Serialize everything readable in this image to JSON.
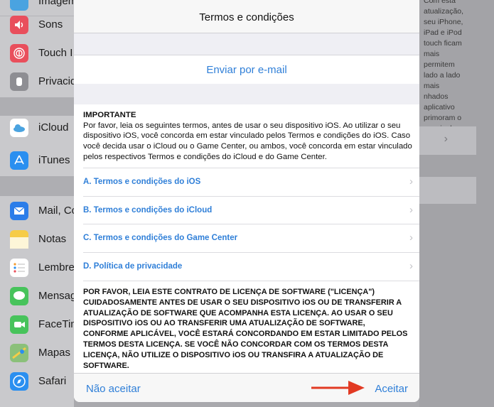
{
  "sidebar": {
    "items": [
      {
        "label": "Imagem de Fundo",
        "icon": "wallpaper-icon",
        "color": "#4aa3e0"
      },
      {
        "label": "Sons",
        "icon": "sounds-icon",
        "color": "#e94f5c"
      },
      {
        "label": "Touch I",
        "icon": "fingerprint-icon",
        "color": "#e94f5c"
      },
      {
        "label": "Privacid",
        "icon": "hand-icon",
        "color": "#8e8e93"
      },
      {
        "label": "iCloud",
        "icon": "icloud-icon",
        "color": "#ffffff"
      },
      {
        "label": "iTunes",
        "icon": "app-store-icon",
        "color": "#2a8ff0"
      },
      {
        "label": "Mail, Co",
        "icon": "mail-icon",
        "color": "#2b7de9"
      },
      {
        "label": "Notas",
        "icon": "notes-icon",
        "color": "#f6cc47"
      },
      {
        "label": "Lembre",
        "icon": "reminders-icon",
        "color": "#ffffff"
      },
      {
        "label": "Mensag",
        "icon": "messages-icon",
        "color": "#47c35b"
      },
      {
        "label": "FaceTim",
        "icon": "facetime-icon",
        "color": "#47c35b"
      },
      {
        "label": "Mapas",
        "icon": "maps-icon",
        "color": "#8bc07a"
      },
      {
        "label": "Safari",
        "icon": "safari-icon",
        "color": "#2a8ff0"
      }
    ]
  },
  "background_text": "Com esta atualização, seu iPhone, iPad e iPod touch ficam mais\npermitem\nlado a lado\nmais\nnhados\naplicativo\nprimoram o\na mais de",
  "modal": {
    "title": "Termos e condições",
    "email_link": "Enviar por e-mail",
    "intro_title": "IMPORTANTE",
    "intro_body": "Por favor, leia os seguintes termos, antes de usar o seu dispositivo iOS. Ao utilizar o seu dispositivo iOS, você concorda em estar vinculado pelos Termos e condições do iOS. Caso você decida usar o iCloud ou o Game Center, ou ambos, você concorda em estar vinculado pelos respectivos Termos e condições do iCloud e do Game Center.",
    "links": [
      "A. Termos e condições do iOS",
      "B. Termos e condições do iCloud",
      "C. Termos e condições do Game Center",
      "D. Política de privacidade"
    ],
    "license_text": "POR FAVOR, LEIA ESTE CONTRATO DE LICENÇA DE SOFTWARE (\"LICENÇA\") CUIDADOSAMENTE ANTES DE USAR O SEU DISPOSITIVO iOS OU DE TRANSFERIR A ATUALIZAÇÃO DE SOFTWARE QUE ACOMPANHA ESTA LICENÇA. AO USAR O SEU DISPOSITIVO iOS OU AO TRANSFERIR UMA ATUALIZAÇÃO DE SOFTWARE, CONFORME APLICÁVEL, VOCÊ ESTARÁ CONCORDANDO EM ESTAR LIMITADO PELOS TERMOS DESTA LICENÇA. SE VOCÊ NÃO CONCORDAR COM OS TERMOS DESTA LICENÇA, NÃO UTILIZE O DISPOSITIVO iOS OU TRANSFIRA A ATUALIZAÇÃO DE SOFTWARE.",
    "decline_label": "Não aceitar",
    "accept_label": "Aceitar"
  },
  "colors": {
    "accent": "#2f7fd8",
    "arrow": "#e23a23"
  }
}
